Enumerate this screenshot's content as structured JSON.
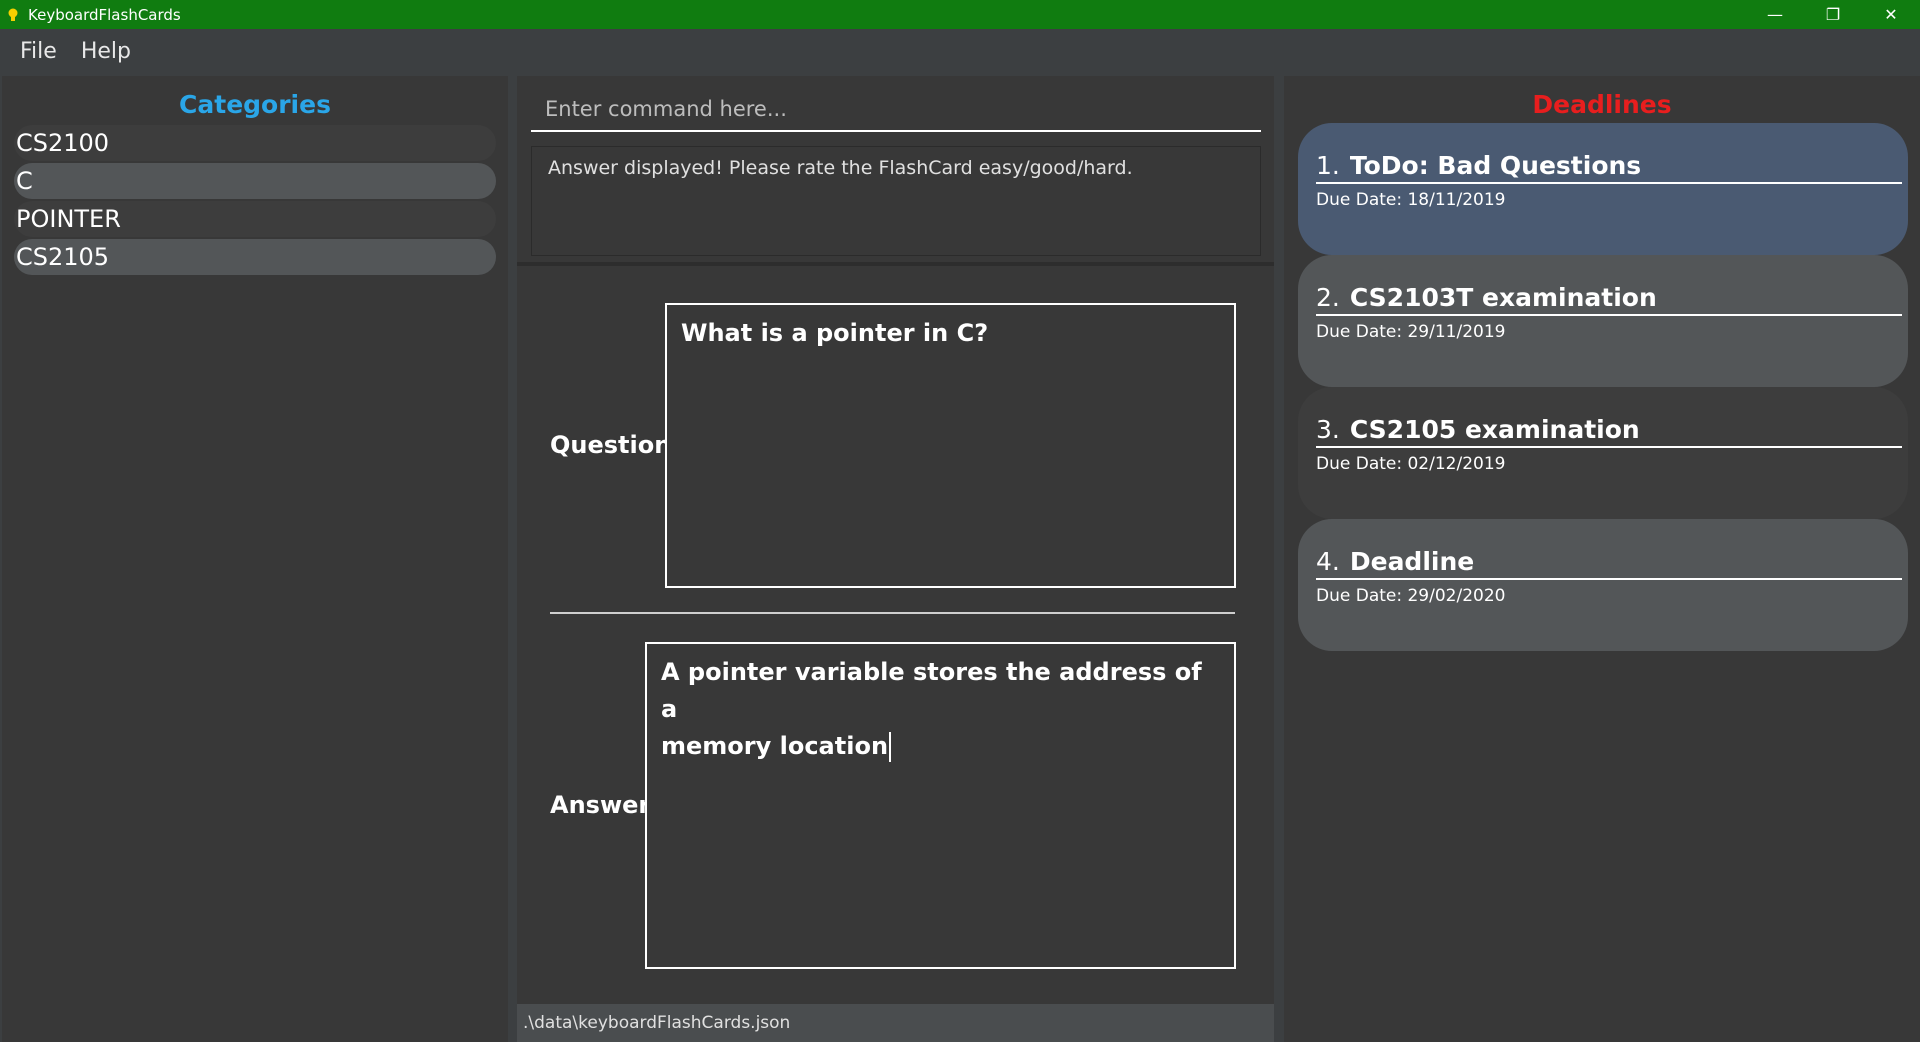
{
  "window": {
    "title": "KeyboardFlashCards",
    "controls": {
      "minimize": "—",
      "restore": "❐",
      "close": "✕"
    }
  },
  "menu": {
    "file": "File",
    "help": "Help"
  },
  "categories": {
    "heading": "Categories",
    "items": [
      {
        "label": "CS2100"
      },
      {
        "label": "C"
      },
      {
        "label": "POINTER"
      },
      {
        "label": "CS2105"
      }
    ]
  },
  "command": {
    "placeholder": "Enter command here...",
    "value": "",
    "result": "Answer displayed! Please rate the FlashCard easy/good/hard."
  },
  "flashcard": {
    "question_label": "Question:",
    "question": "What is a pointer in C?",
    "answer_label": "Answer:",
    "answer_line1": "A pointer variable stores the address of a",
    "answer_line2": "memory location"
  },
  "status": {
    "file_path": ".\\data\\keyboardFlashCards.json"
  },
  "deadlines": {
    "heading": "Deadlines",
    "items": [
      {
        "num": "1.",
        "title": "ToDo: Bad Questions",
        "due": "Due Date: 18/11/2019"
      },
      {
        "num": "2.",
        "title": "CS2103T examination",
        "due": "Due Date: 29/11/2019"
      },
      {
        "num": "3.",
        "title": "CS2105 examination",
        "due": "Due Date: 02/12/2019"
      },
      {
        "num": "4.",
        "title": "Deadline",
        "due": "Due Date: 29/02/2020"
      }
    ]
  },
  "colors": {
    "titlebar": "#107c10",
    "categories_heading": "#2aa6e8",
    "deadlines_heading": "#e81e1e",
    "selected_deadline": "#4a5a72"
  }
}
